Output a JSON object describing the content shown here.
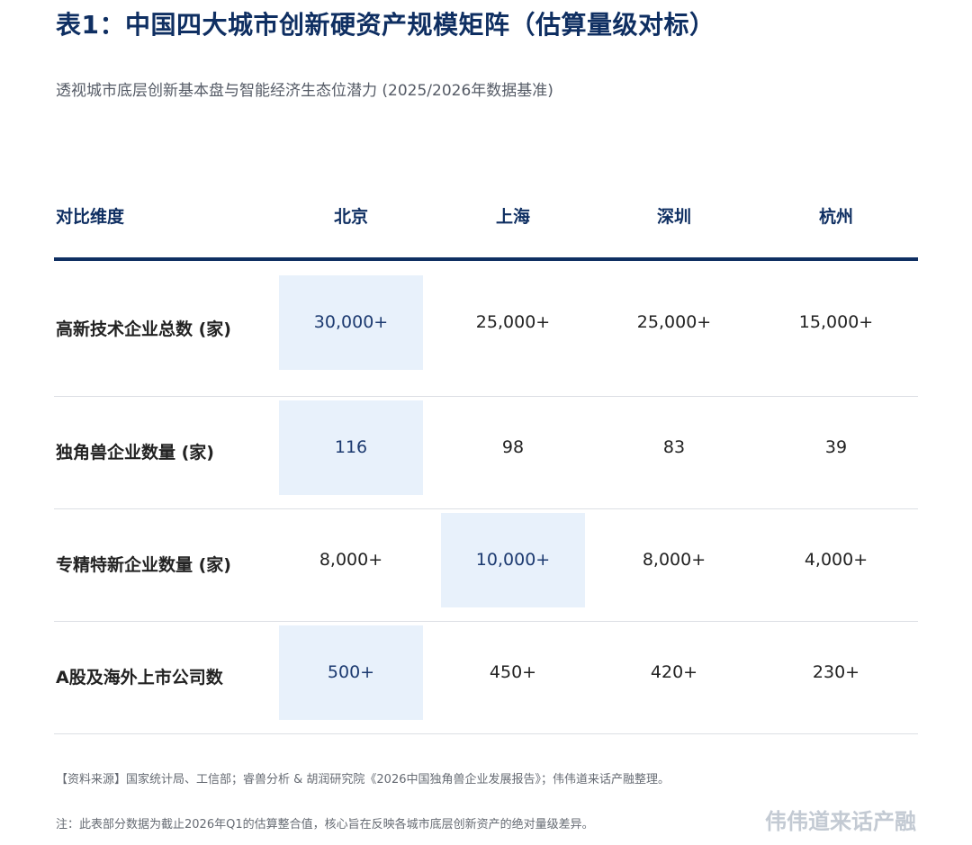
{
  "title": "表1：中国四大城市创新硬资产规模矩阵（估算量级对标）",
  "subtitle": "透视城市底层创新基本盘与智能经济生态位潜力 (2025/2026年数据基准)",
  "table": {
    "headers": [
      "对比维度",
      "北京",
      "上海",
      "深圳",
      "杭州"
    ],
    "rows": [
      {
        "label": "高新技术企业总数 (家)",
        "values": [
          "30,000+",
          "25,000+",
          "25,000+",
          "15,000+"
        ],
        "highlight_col": 0
      },
      {
        "label": "独角兽企业数量 (家)",
        "values": [
          "116",
          "98",
          "83",
          "39"
        ],
        "highlight_col": 0
      },
      {
        "label": "专精特新企业数量 (家)",
        "values": [
          "8,000+",
          "10,000+",
          "8,000+",
          "4,000+"
        ],
        "highlight_col": 1
      },
      {
        "label": "A股及海外上市公司数",
        "values": [
          "500+",
          "450+",
          "420+",
          "230+"
        ],
        "highlight_col": 0
      }
    ]
  },
  "footer": {
    "source": "【资料来源】国家统计局、工信部；睿兽分析 & 胡润研究院《2026中国独角兽企业发展报告》；伟伟道来话产融整理。",
    "note": "注：此表部分数据为截止2026年Q1的估算整合值，核心旨在反映各城市底层创新资产的绝对量级差异。",
    "brand": "伟伟道来话产融"
  },
  "colors": {
    "title": "#0f2f62",
    "highlight_bg": "#e8f1fb",
    "rule": "#0f2f62",
    "brand": "#c3cad3"
  }
}
